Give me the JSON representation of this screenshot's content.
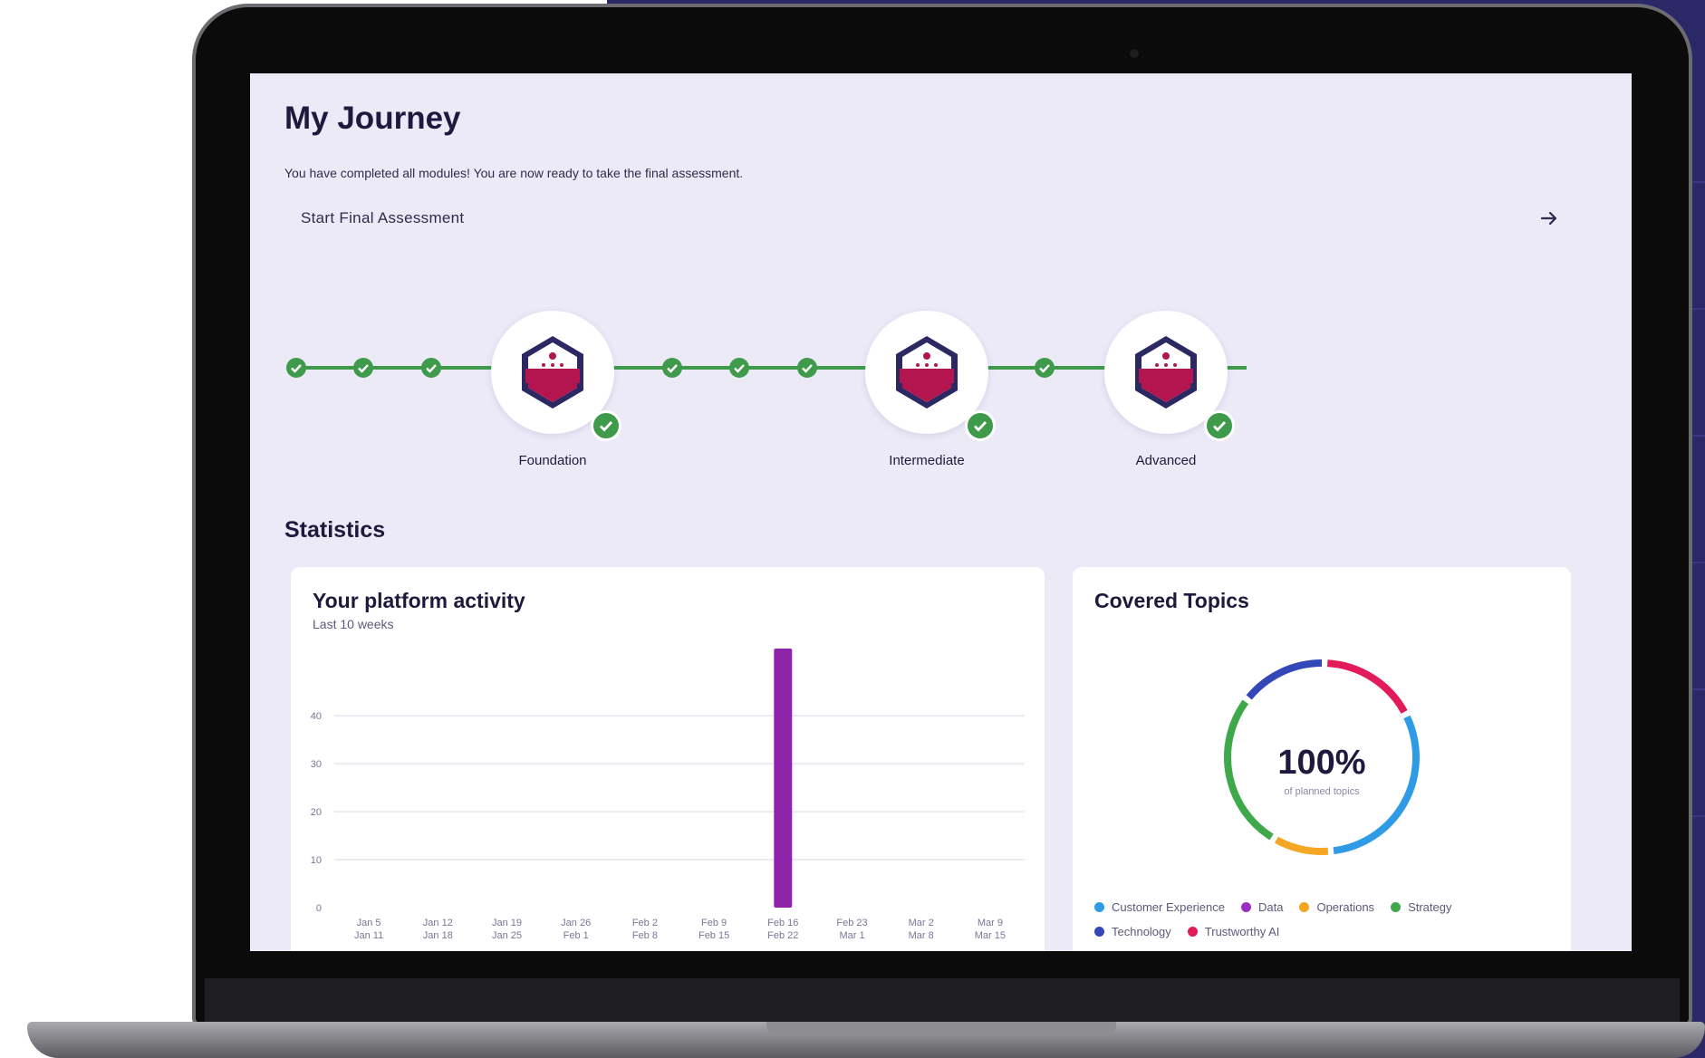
{
  "journey": {
    "title": "My Journey",
    "subtitle": "You have completed all modules! You are now ready to take the final assessment.",
    "cta_label": "Start Final Assessment",
    "milestones": [
      {
        "label": "Foundation"
      },
      {
        "label": "Intermediate"
      },
      {
        "label": "Advanced"
      }
    ],
    "step_color": "#3f9b4b"
  },
  "statistics": {
    "title": "Statistics",
    "activity": {
      "title": "Your platform activity",
      "subtitle": "Last 10 weeks"
    },
    "topics": {
      "title": "Covered Topics",
      "percent": "100%",
      "percent_label": "of planned topics",
      "legend": [
        {
          "label": "Customer Experience",
          "color": "#2f9be6"
        },
        {
          "label": "Data",
          "color": "#9b30c0"
        },
        {
          "label": "Operations",
          "color": "#f5a623"
        },
        {
          "label": "Strategy",
          "color": "#3fa84a"
        },
        {
          "label": "Technology",
          "color": "#3447b8"
        },
        {
          "label": "Trustworthy AI",
          "color": "#e21b5a"
        }
      ]
    }
  },
  "chart_data": {
    "type": "bar",
    "title": "Your platform activity",
    "subtitle": "Last 10 weeks",
    "categories": [
      [
        "Jan 5",
        "Jan 11"
      ],
      [
        "Jan 12",
        "Jan 18"
      ],
      [
        "Jan 19",
        "Jan 25"
      ],
      [
        "Jan 26",
        "Feb 1"
      ],
      [
        "Feb 2",
        "Feb 8"
      ],
      [
        "Feb 9",
        "Feb 15"
      ],
      [
        "Feb 16",
        "Feb 22"
      ],
      [
        "Feb 23",
        "Mar 1"
      ],
      [
        "Mar 2",
        "Mar 8"
      ],
      [
        "Mar 9",
        "Mar 15"
      ]
    ],
    "values": [
      0,
      0,
      0,
      0,
      0,
      0,
      54,
      0,
      0,
      0
    ],
    "yticks": [
      0,
      10,
      20,
      30,
      40
    ],
    "ylim": [
      0,
      54
    ],
    "bar_color": "#8e24aa",
    "grid": true
  },
  "donut_data": {
    "type": "pie",
    "segments": [
      {
        "label": "Trustworthy AI",
        "value": 17,
        "color": "#e21b5a"
      },
      {
        "label": "Customer Experience",
        "value": 31,
        "color": "#2f9be6"
      },
      {
        "label": "Operations",
        "value": 10,
        "color": "#f5a623"
      },
      {
        "label": "Strategy",
        "value": 27,
        "color": "#3fa84a"
      },
      {
        "label": "Technology",
        "value": 15,
        "color": "#3447b8"
      }
    ]
  }
}
